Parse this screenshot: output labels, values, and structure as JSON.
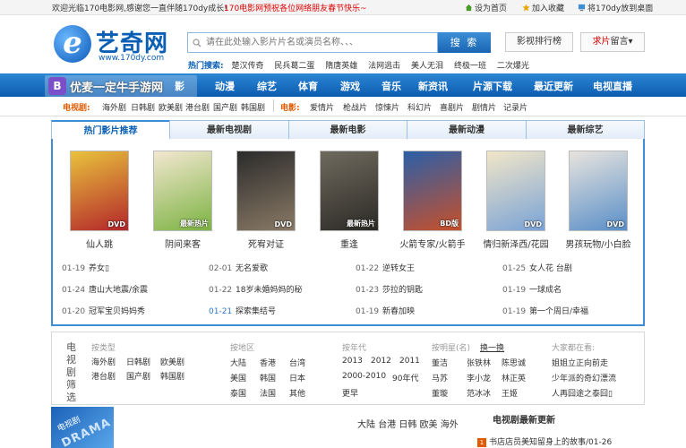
{
  "topbar": {
    "welcome": "欢迎光临170电影网,感谢您一直伴随170dy成长!",
    "notice": "170电影网预祝各位网络朋友春节快乐~",
    "links": [
      "设为首页",
      "加入收藏",
      "将170dy放到桌面"
    ]
  },
  "logo": {
    "mark": "e",
    "name": "艺奇网",
    "url": "www.170dy.com"
  },
  "search": {
    "placeholder": "请在此处输入影片片名或演员名称、、、",
    "button": "搜 索"
  },
  "header": {
    "rank_button": "影视排行榜",
    "request_red": "求片",
    "request_rest": "留言▾"
  },
  "hot_search": {
    "label": "热门搜索:",
    "items": [
      "楚汉传奇",
      "民兵葛二蛋",
      "隋唐英雄",
      "法网逃击",
      "美人无泪",
      "终极一班",
      "二次爆光"
    ]
  },
  "watermark": {
    "icon": "B",
    "text": "优麦一定牛手游网"
  },
  "nav": {
    "items": [
      "影",
      "动漫",
      "综艺",
      "体育",
      "游戏",
      "音乐",
      "新资讯",
      "片源下载",
      "最近更新",
      "电视直播"
    ]
  },
  "subnav": {
    "tv_label": "电视剧:",
    "tv_items": [
      "海外剧",
      "日韩剧",
      "欧美剧",
      "港台剧",
      "国产剧",
      "韩国剧"
    ],
    "movie_label": "电影:",
    "movie_items": [
      "爱情片",
      "枪战片",
      "惊悚片",
      "科幻片",
      "喜剧片",
      "剧情片",
      "记录片"
    ]
  },
  "tabs": [
    "热门影片推荐",
    "最新电视剧",
    "最新电影",
    "最新动漫",
    "最新综艺"
  ],
  "posters": [
    {
      "title": "仙人跳",
      "tag": "DVD",
      "color1": "#e9c23c",
      "color2": "#b3262b"
    },
    {
      "title": "阴间来客",
      "tag": "最新热片",
      "color1": "#f3e7d0",
      "color2": "#7cb342"
    },
    {
      "title": "死宥对证",
      "tag": "DVD",
      "color1": "#2b2b2b",
      "color2": "#8a7a66"
    },
    {
      "title": "重逢",
      "tag": "最新热片",
      "color1": "#6f6a5e",
      "color2": "#2c2a26"
    },
    {
      "title": "火箭专家/火箭手",
      "tag": "BD版",
      "color1": "#2b5fa8",
      "color2": "#c8502a"
    },
    {
      "title": "情归新泽西/花园",
      "tag": "DVD",
      "color1": "#f2e6c8",
      "color2": "#7aa3d6"
    },
    {
      "title": "男孩玩物/小白脸",
      "tag": "DVD",
      "color1": "#e8e4de",
      "color2": "#5a8fc8"
    }
  ],
  "updates": [
    [
      {
        "date": "01-19",
        "title": "养女▯"
      },
      {
        "date": "01-24",
        "title": "唐山大地震/余震"
      },
      {
        "date": "01-20",
        "title": "冠军宝贝妈妈秀"
      }
    ],
    [
      {
        "date": "02-01",
        "title": "无名爱歌"
      },
      {
        "date": "01-22",
        "title": "18岁未婚妈妈的秘"
      },
      {
        "date": "01-21",
        "title": "探索集结号"
      }
    ],
    [
      {
        "date": "01-22",
        "title": "逆转女王"
      },
      {
        "date": "01-23",
        "title": "莎拉的钥匙"
      },
      {
        "date": "01-19",
        "title": "新春加映"
      }
    ],
    [
      {
        "date": "01-25",
        "title": "女人花 台剧"
      },
      {
        "date": "01-19",
        "title": "一球成名"
      },
      {
        "date": "01-19",
        "title": "第一个周日/幸福"
      }
    ]
  ],
  "filter": {
    "head": "电视剧筛选",
    "by_type": {
      "title": "按类型",
      "items": [
        "海外剧",
        "日韩剧",
        "欧美剧",
        "港台剧",
        "国产剧",
        "韩国剧"
      ]
    },
    "by_region": {
      "title": "按地区",
      "items": [
        "大陆",
        "香港",
        "台湾",
        "美国",
        "韩国",
        "日本",
        "泰国",
        "法国",
        "其他"
      ]
    },
    "by_year": {
      "title": "按年代",
      "items": [
        "2013",
        "2012",
        "2011",
        "2000-2010",
        "90年代",
        "更早"
      ]
    },
    "by_star": {
      "title": "按明星(名)",
      "change": "换一换",
      "items": [
        "董洁",
        "张铁林",
        "陈思诚",
        "马苏",
        "李小龙",
        "林正英",
        "董璇",
        "范冰冰",
        "王姬"
      ]
    },
    "searching": {
      "title": "大家都在看:",
      "items": [
        "姐姐立正向前走",
        "少年派的奇幻漂流",
        "人再囧途之泰囧▯"
      ]
    }
  },
  "bottom": {
    "drama_label": "电视剧",
    "drama_word": "DRAMA",
    "regions": [
      "大陆",
      "台港",
      "日韩",
      "欧美",
      "海外"
    ],
    "latest_title": "电视剧最新更新",
    "latest_num": "1",
    "latest_item": "书店店员美知留身上的故事",
    "latest_date": "/01-26"
  }
}
